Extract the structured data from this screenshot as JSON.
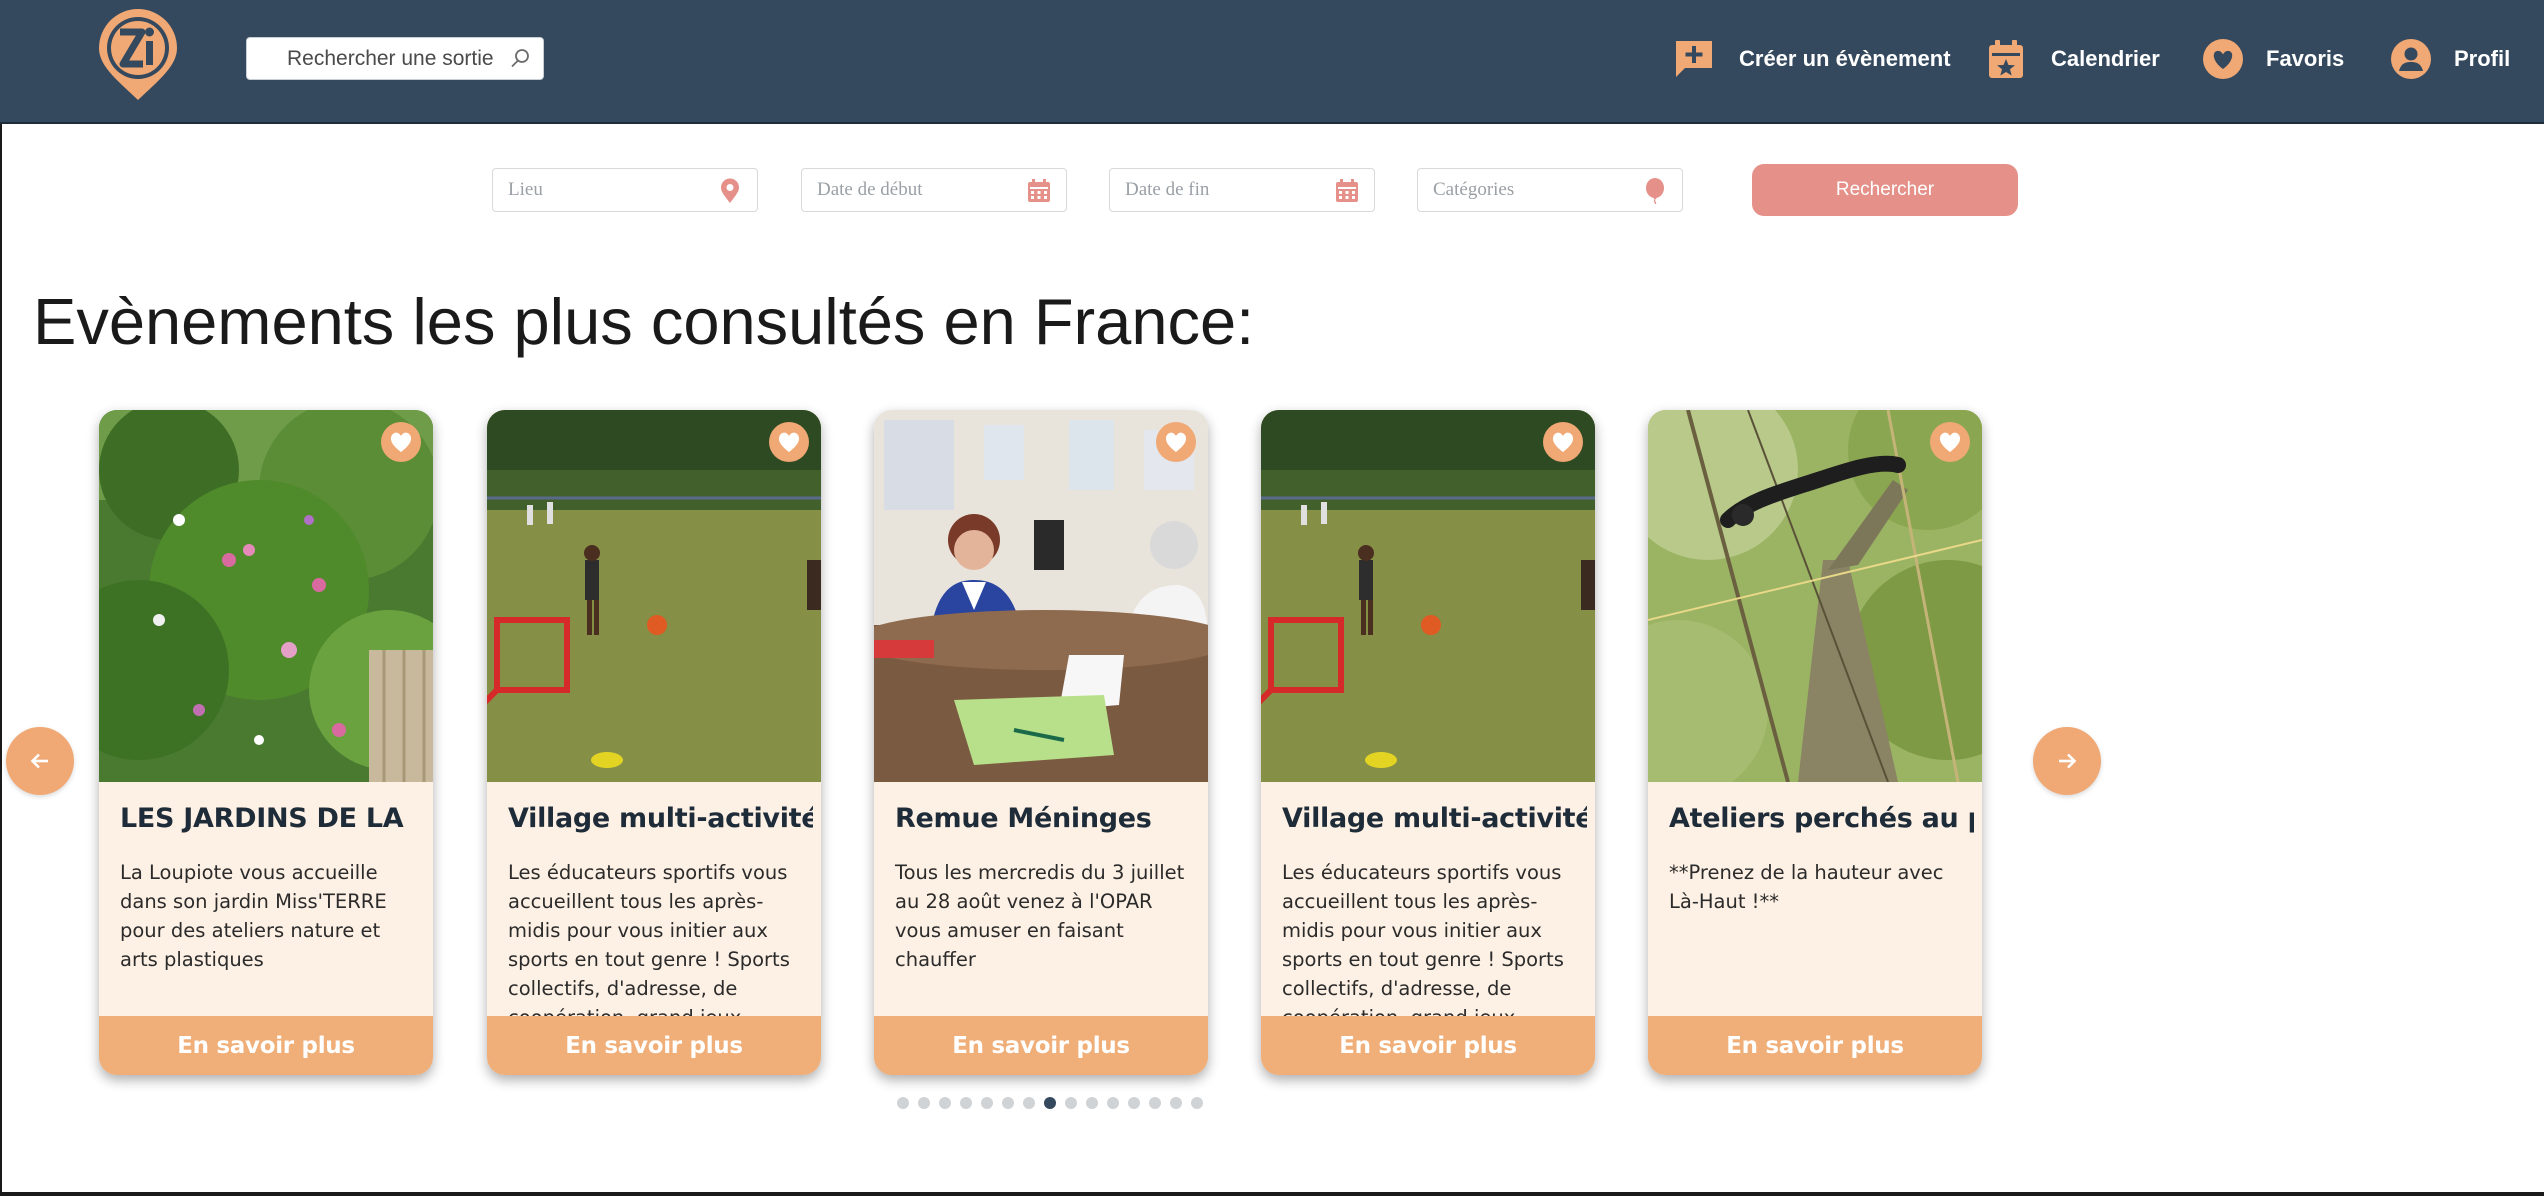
{
  "header": {
    "logo_label": "OZI",
    "search": {
      "placeholder": "Rechercher une sortie",
      "value": ""
    },
    "nav": [
      {
        "label": "Créer un évènement",
        "icon": "add-comment-icon"
      },
      {
        "label": "Calendrier",
        "icon": "calendar-icon"
      },
      {
        "label": "Favoris",
        "icon": "heart-icon"
      },
      {
        "label": "Profil",
        "icon": "user-icon"
      }
    ]
  },
  "filters": {
    "lieu": {
      "placeholder": "Lieu",
      "icon": "map-pin-icon"
    },
    "date_debut": {
      "placeholder": "Date de début",
      "icon": "calendar-icon"
    },
    "date_fin": {
      "placeholder": "Date de fin",
      "icon": "calendar-icon"
    },
    "categories": {
      "placeholder": "Catégories",
      "icon": "balloon-icon"
    },
    "search_label": "Rechercher"
  },
  "section_title": "Evènements les plus consultés en France:",
  "cards": [
    {
      "title": "LES JARDINS DE LA",
      "description": "La Loupiote vous accueille dans son jardin Miss'TERRE pour des ateliers nature et arts plastiques",
      "button": "En savoir plus"
    },
    {
      "title": "Village multi-activités",
      "description": "Les éducateurs sportifs vous accueillent tous les après-midis pour vous initier aux sports en tout genre ! Sports collectifs, d'adresse, de coopération, grand jeux ...",
      "button": "En savoir plus"
    },
    {
      "title": "Remue Méninges",
      "description": "Tous les mercredis du 3 juillet au 28 août venez à l'OPAR vous amuser en faisant chauffer",
      "button": "En savoir plus"
    },
    {
      "title": "Village multi-activités",
      "description": "Les éducateurs sportifs vous accueillent tous les après-midis pour vous initier aux sports en tout genre ! Sports collectifs, d'adresse, de coopération, grand jeux ...",
      "button": "En savoir plus"
    },
    {
      "title": "Ateliers perchés au parc",
      "description": "**Prenez de la hauteur avec Là-Haut !**",
      "button": "En savoir plus"
    }
  ],
  "carousel": {
    "total_pages": 15,
    "active_page": 8
  },
  "colors": {
    "header_bg": "#34495e",
    "accent_orange": "#f0a874",
    "card_bg": "#fdf0e4",
    "search_button": "#e5918a"
  }
}
